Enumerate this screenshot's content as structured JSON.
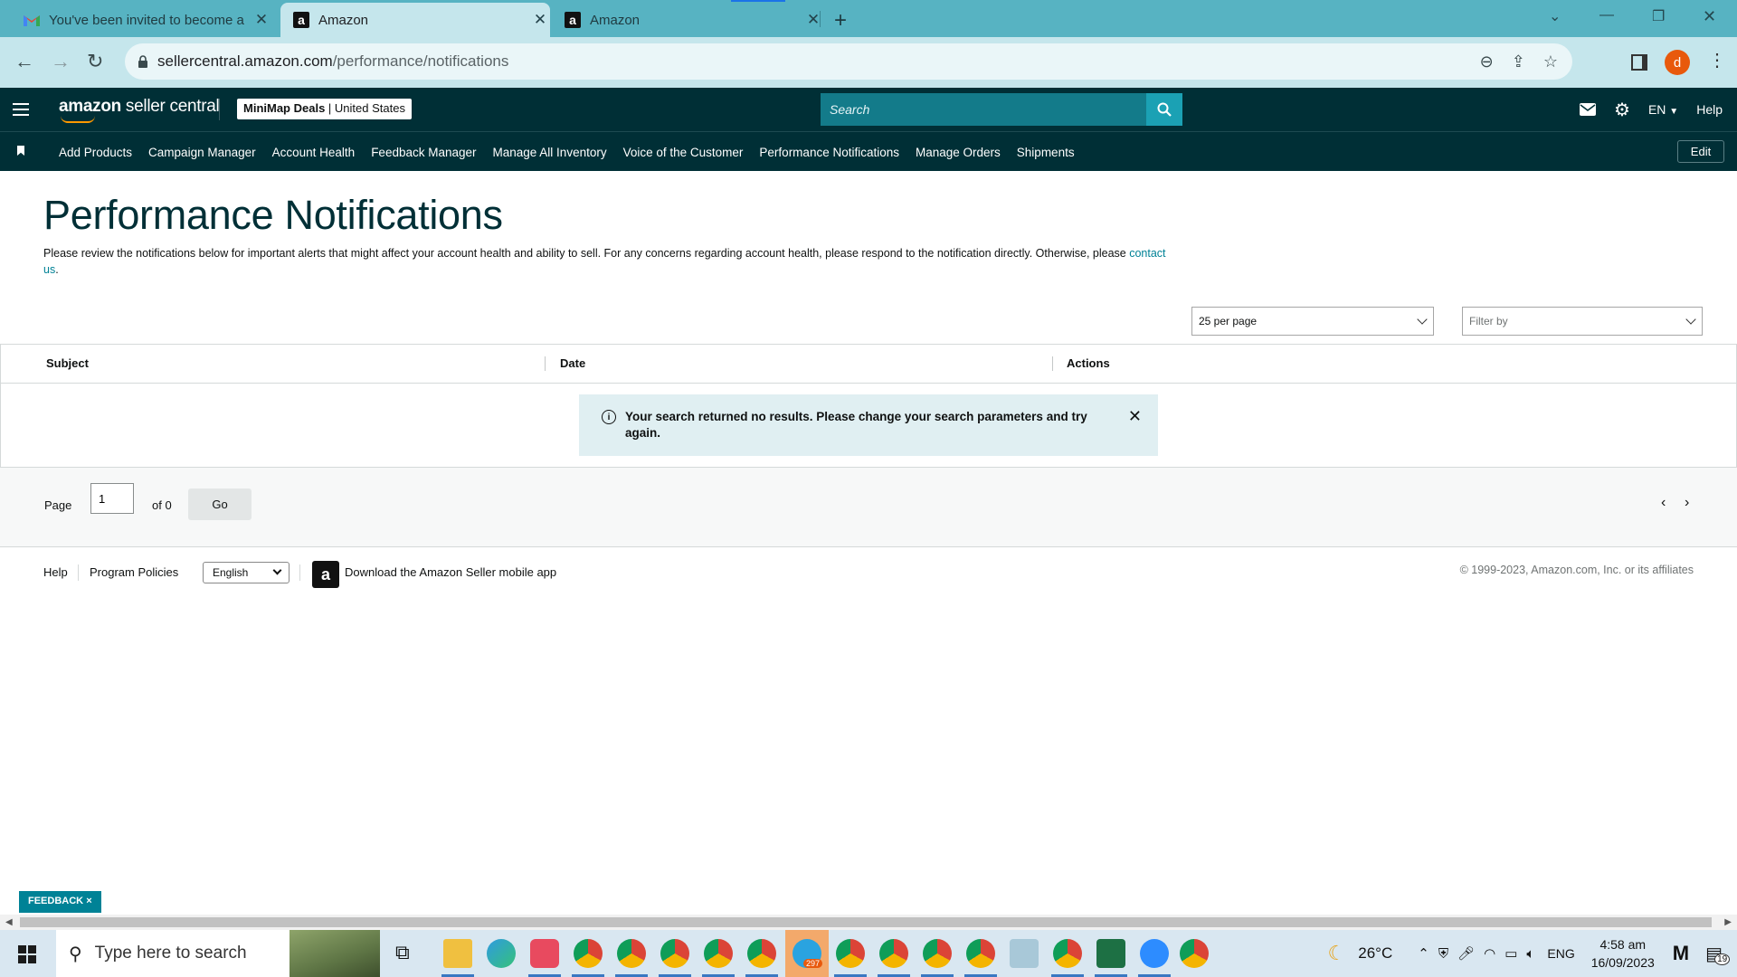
{
  "browser": {
    "tabs": [
      {
        "title": "You've been invited to become a",
        "favicon": "gmail-icon"
      },
      {
        "title": "Amazon",
        "favicon": "amazon-icon"
      },
      {
        "title": "Amazon",
        "favicon": "amazon-icon"
      }
    ],
    "url_host": "sellercentral.amazon.com",
    "url_path": "/performance/notifications"
  },
  "header": {
    "logo_bold": "amazon",
    "logo_text": " seller central",
    "store_name": "MiniMap Deals",
    "store_sep": " | ",
    "store_region": "United States",
    "search_placeholder": "Search",
    "language": "EN",
    "help": "Help"
  },
  "nav": {
    "items": [
      "Add Products",
      "Campaign Manager",
      "Account Health",
      "Feedback Manager",
      "Manage All Inventory",
      "Voice of the Customer",
      "Performance Notifications",
      "Manage Orders",
      "Shipments"
    ],
    "edit": "Edit"
  },
  "main": {
    "title": "Performance Notifications",
    "description": "Please review the notifications below for important alerts that might affect your account health and ability to sell. For any concerns regarding account health, please respond to the notification directly. Otherwise, please ",
    "contact_link": "contact us",
    "description_end": ".",
    "per_page": "25 per page",
    "filter_placeholder": "Filter by",
    "columns": [
      "Subject",
      "Date",
      "Actions"
    ],
    "alert_message": "Your search returned no results. Please change your search parameters and try again.",
    "pager": {
      "page_label": "Page",
      "page_value": "1",
      "of_label": "of 0",
      "go": "Go"
    }
  },
  "footer": {
    "help": "Help",
    "program_policies": "Program Policies",
    "language": "English",
    "app_download": "Download the Amazon Seller mobile app",
    "copyright": "© 1999-2023, Amazon.com, Inc. or its affiliates"
  },
  "feedback": {
    "label": "FEEDBACK",
    "close": "×"
  },
  "taskbar": {
    "search_placeholder": "Type here to search",
    "weather": "26°C",
    "language": "ENG",
    "time": "4:58 am",
    "date": "16/09/2023",
    "telegram_badge": "297",
    "notification_count": "19"
  },
  "colors": {
    "tab_strip": "#57b3c2",
    "header_bg": "#002f36",
    "search_bg": "#137b8a",
    "accent": "#008296",
    "alert_bg": "#e0eff2"
  }
}
